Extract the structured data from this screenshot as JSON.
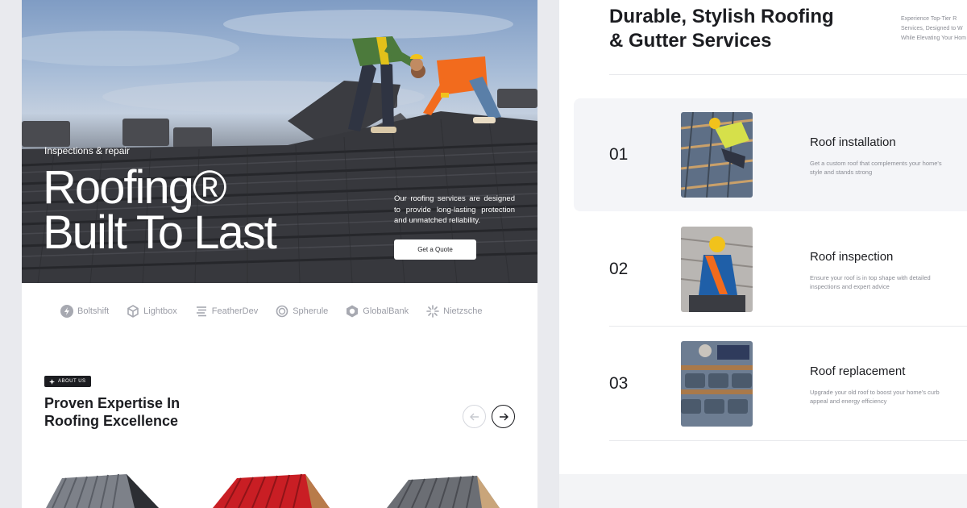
{
  "hero": {
    "eyebrow": "Inspections & repair",
    "title_line1": "Roofing®",
    "title_line2": "Built To Last",
    "description": "Our roofing services are designed to provide long-lasting protection and unmatched reliability.",
    "cta_label": "Get a Quote"
  },
  "logos": [
    {
      "name": "Boltshift",
      "icon": "bolt-icon"
    },
    {
      "name": "Lightbox",
      "icon": "cube-icon"
    },
    {
      "name": "FeatherDev",
      "icon": "lines-icon"
    },
    {
      "name": "Spherule",
      "icon": "sphere-icon"
    },
    {
      "name": "GlobalBank",
      "icon": "hexagon-icon"
    },
    {
      "name": "Nietzsche",
      "icon": "starburst-icon"
    }
  ],
  "about": {
    "badge": "ABOUT US",
    "title_line1": "Proven Expertise In",
    "title_line2": "Roofing Excellence"
  },
  "services_header": {
    "title_line1": "Durable, Stylish Roofing",
    "title_line2": "& Gutter Services",
    "side_line1": "Experience Top-Tier R",
    "side_line2": "Services, Designed to W",
    "side_line3": "While Elevating Your Hom"
  },
  "services": [
    {
      "num": "01",
      "name": "Roof installation",
      "desc": "Get a custom roof that complements your home's style and stands strong"
    },
    {
      "num": "02",
      "name": "Roof inspection",
      "desc": "Ensure your roof is in top shape with detailed inspections and expert advice"
    },
    {
      "num": "03",
      "name": "Roof replacement",
      "desc": "Upgrade your old roof to boost your home's curb appeal and energy efficiency"
    }
  ],
  "colors": {
    "ink": "#1c1d21",
    "muted": "#8a8c94",
    "active_row": "#f4f5f8",
    "worker_orange": "#f26b1d",
    "roof_red": "#c91e24"
  }
}
